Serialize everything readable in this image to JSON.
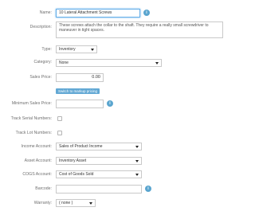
{
  "form": {
    "name": {
      "label": "Name:",
      "value": "10 Lateral Attachment Screws"
    },
    "description": {
      "label": "Description:",
      "value": "These screws attach the collar to the shaft. They require a really small screwdriver to maneuver in tight spaces."
    },
    "type": {
      "label": "Type:",
      "value": "Inventory"
    },
    "category": {
      "label": "Category:",
      "value": "None"
    },
    "sales_price": {
      "label": "Sales Price:",
      "value": "0.00"
    },
    "markup_button": "Switch to markup pricing",
    "minimum_sales_price": {
      "label": "Minimum Sales Price:",
      "value": ""
    },
    "track_serial_numbers": {
      "label": "Track Serial Numbers:",
      "checked": false
    },
    "track_lot_numbers": {
      "label": "Track Lot Numbers:",
      "checked": false
    },
    "income_account": {
      "label": "Income Account:",
      "value": "Sales of Product Income"
    },
    "asset_account": {
      "label": "Asset Account:",
      "value": "Inventory Asset"
    },
    "cogs_account": {
      "label": "COGS Account:",
      "value": "Cost of Goods Sold"
    },
    "barcode": {
      "label": "Barcode:",
      "value": ""
    },
    "warranty": {
      "label": "Warranty:",
      "value": "( none )"
    }
  },
  "info_icon_glyph": "i",
  "colors": {
    "accent": "#62a8d4",
    "focus_border": "#66afe9",
    "info_icon": "#5aa5cf"
  }
}
